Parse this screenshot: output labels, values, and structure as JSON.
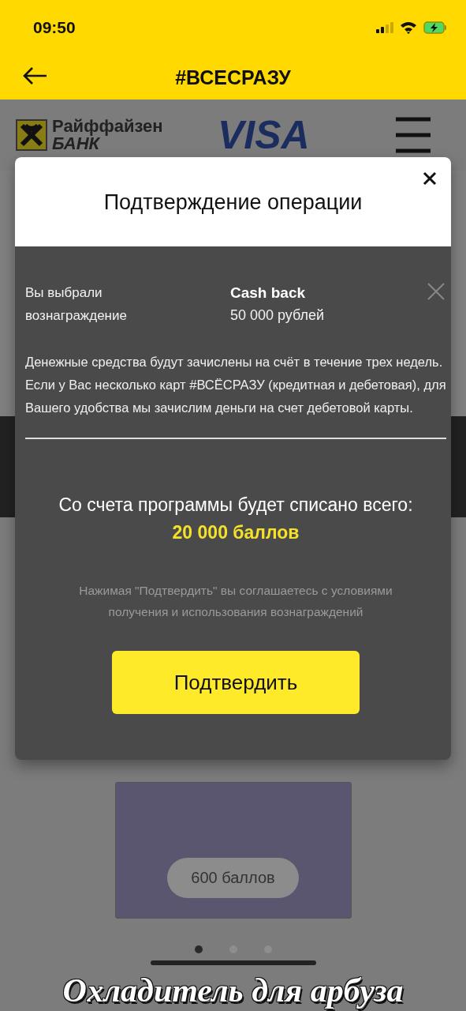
{
  "status_bar": {
    "time": "09:50"
  },
  "header": {
    "title": "#ВСЕСРАЗУ"
  },
  "brand": {
    "bank_name": "Райффайзен",
    "bank_subtitle": "БАНК",
    "card_logo": "VISA"
  },
  "background_card": {
    "price": "600 баллов"
  },
  "carousel_dots": [
    {
      "selected": true
    },
    {
      "selected": false
    },
    {
      "selected": false
    }
  ],
  "dialog": {
    "title": "Подтверждение операции",
    "reward_label": "Вы выбрали вознаграждение",
    "reward_name": "Cash back",
    "reward_amount": "50 000 рублей",
    "description": "Денежные средства будут зачислены на счёт в течение трех недель. Если у Вас несколько карт #ВСЁСРАЗУ (кредитная и дебетовая), для Вашего удобства мы зачислим деньги на счет дебетовой карты.",
    "total_label": "Со счета программы будет списано всего:",
    "total_value": "20 000 баллов",
    "disclaimer": "Нажимая \"Подтвердить\" вы соглашаетесь с условиями получения и использования вознаграждений",
    "confirm_button": "Подтвердить"
  },
  "caption": "Охладитель для арбуза"
}
